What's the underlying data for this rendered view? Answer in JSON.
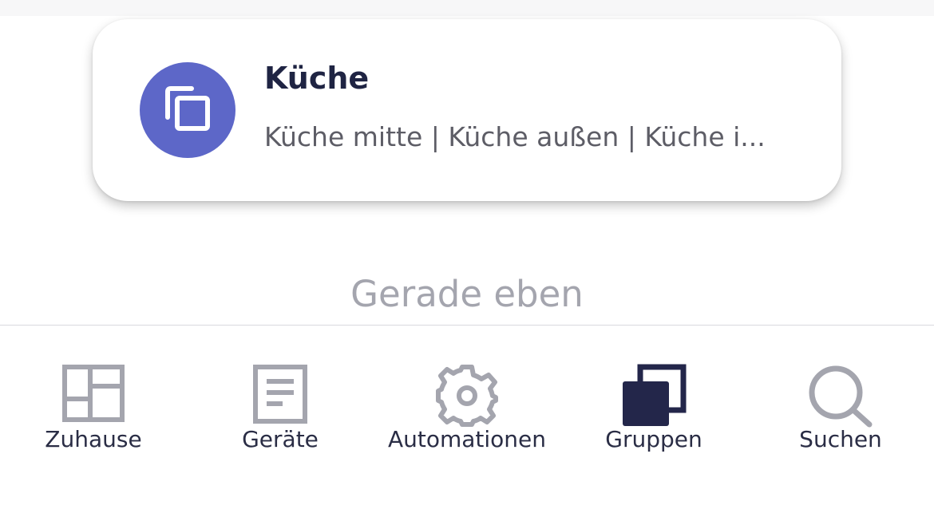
{
  "group_card": {
    "title": "Küche",
    "subtitle": "Küche mitte | Küche außen | Küche i...",
    "icon": "group-icon",
    "accent_color": "#5d67c8"
  },
  "timestamp": "Gerade eben",
  "tab_bar": {
    "active_tab": "Gruppen",
    "active_color": "#23264a",
    "inactive_color": "#a4a5ae",
    "tabs": [
      {
        "label": "Zuhause",
        "icon": "dashboard-icon"
      },
      {
        "label": "Geräte",
        "icon": "document-icon"
      },
      {
        "label": "Automationen",
        "icon": "gear-icon"
      },
      {
        "label": "Gruppen",
        "icon": "group-icon"
      },
      {
        "label": "Suchen",
        "icon": "search-icon"
      }
    ]
  }
}
